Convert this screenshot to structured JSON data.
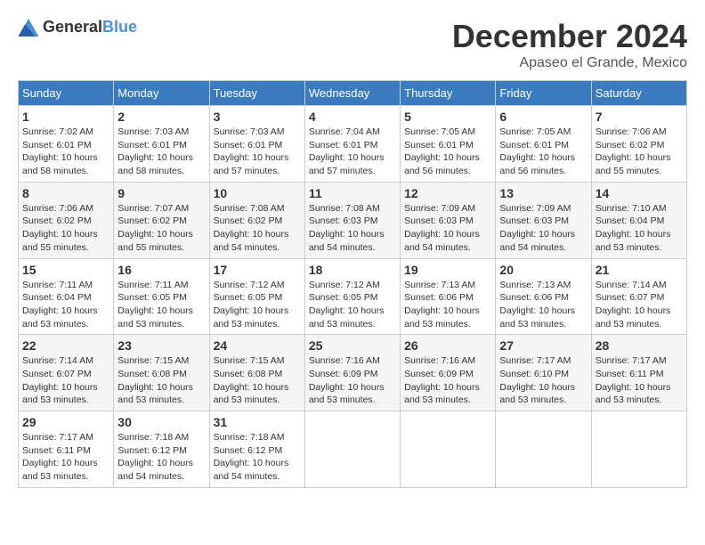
{
  "logo": {
    "general": "General",
    "blue": "Blue"
  },
  "header": {
    "month": "December 2024",
    "location": "Apaseo el Grande, Mexico"
  },
  "weekdays": [
    "Sunday",
    "Monday",
    "Tuesday",
    "Wednesday",
    "Thursday",
    "Friday",
    "Saturday"
  ],
  "weeks": [
    [
      {
        "day": "1",
        "info": "Sunrise: 7:02 AM\nSunset: 6:01 PM\nDaylight: 10 hours\nand 58 minutes."
      },
      {
        "day": "2",
        "info": "Sunrise: 7:03 AM\nSunset: 6:01 PM\nDaylight: 10 hours\nand 58 minutes."
      },
      {
        "day": "3",
        "info": "Sunrise: 7:03 AM\nSunset: 6:01 PM\nDaylight: 10 hours\nand 57 minutes."
      },
      {
        "day": "4",
        "info": "Sunrise: 7:04 AM\nSunset: 6:01 PM\nDaylight: 10 hours\nand 57 minutes."
      },
      {
        "day": "5",
        "info": "Sunrise: 7:05 AM\nSunset: 6:01 PM\nDaylight: 10 hours\nand 56 minutes."
      },
      {
        "day": "6",
        "info": "Sunrise: 7:05 AM\nSunset: 6:01 PM\nDaylight: 10 hours\nand 56 minutes."
      },
      {
        "day": "7",
        "info": "Sunrise: 7:06 AM\nSunset: 6:02 PM\nDaylight: 10 hours\nand 55 minutes."
      }
    ],
    [
      {
        "day": "8",
        "info": "Sunrise: 7:06 AM\nSunset: 6:02 PM\nDaylight: 10 hours\nand 55 minutes."
      },
      {
        "day": "9",
        "info": "Sunrise: 7:07 AM\nSunset: 6:02 PM\nDaylight: 10 hours\nand 55 minutes."
      },
      {
        "day": "10",
        "info": "Sunrise: 7:08 AM\nSunset: 6:02 PM\nDaylight: 10 hours\nand 54 minutes."
      },
      {
        "day": "11",
        "info": "Sunrise: 7:08 AM\nSunset: 6:03 PM\nDaylight: 10 hours\nand 54 minutes."
      },
      {
        "day": "12",
        "info": "Sunrise: 7:09 AM\nSunset: 6:03 PM\nDaylight: 10 hours\nand 54 minutes."
      },
      {
        "day": "13",
        "info": "Sunrise: 7:09 AM\nSunset: 6:03 PM\nDaylight: 10 hours\nand 54 minutes."
      },
      {
        "day": "14",
        "info": "Sunrise: 7:10 AM\nSunset: 6:04 PM\nDaylight: 10 hours\nand 53 minutes."
      }
    ],
    [
      {
        "day": "15",
        "info": "Sunrise: 7:11 AM\nSunset: 6:04 PM\nDaylight: 10 hours\nand 53 minutes."
      },
      {
        "day": "16",
        "info": "Sunrise: 7:11 AM\nSunset: 6:05 PM\nDaylight: 10 hours\nand 53 minutes."
      },
      {
        "day": "17",
        "info": "Sunrise: 7:12 AM\nSunset: 6:05 PM\nDaylight: 10 hours\nand 53 minutes."
      },
      {
        "day": "18",
        "info": "Sunrise: 7:12 AM\nSunset: 6:05 PM\nDaylight: 10 hours\nand 53 minutes."
      },
      {
        "day": "19",
        "info": "Sunrise: 7:13 AM\nSunset: 6:06 PM\nDaylight: 10 hours\nand 53 minutes."
      },
      {
        "day": "20",
        "info": "Sunrise: 7:13 AM\nSunset: 6:06 PM\nDaylight: 10 hours\nand 53 minutes."
      },
      {
        "day": "21",
        "info": "Sunrise: 7:14 AM\nSunset: 6:07 PM\nDaylight: 10 hours\nand 53 minutes."
      }
    ],
    [
      {
        "day": "22",
        "info": "Sunrise: 7:14 AM\nSunset: 6:07 PM\nDaylight: 10 hours\nand 53 minutes."
      },
      {
        "day": "23",
        "info": "Sunrise: 7:15 AM\nSunset: 6:08 PM\nDaylight: 10 hours\nand 53 minutes."
      },
      {
        "day": "24",
        "info": "Sunrise: 7:15 AM\nSunset: 6:08 PM\nDaylight: 10 hours\nand 53 minutes."
      },
      {
        "day": "25",
        "info": "Sunrise: 7:16 AM\nSunset: 6:09 PM\nDaylight: 10 hours\nand 53 minutes."
      },
      {
        "day": "26",
        "info": "Sunrise: 7:16 AM\nSunset: 6:09 PM\nDaylight: 10 hours\nand 53 minutes."
      },
      {
        "day": "27",
        "info": "Sunrise: 7:17 AM\nSunset: 6:10 PM\nDaylight: 10 hours\nand 53 minutes."
      },
      {
        "day": "28",
        "info": "Sunrise: 7:17 AM\nSunset: 6:11 PM\nDaylight: 10 hours\nand 53 minutes."
      }
    ],
    [
      {
        "day": "29",
        "info": "Sunrise: 7:17 AM\nSunset: 6:11 PM\nDaylight: 10 hours\nand 53 minutes."
      },
      {
        "day": "30",
        "info": "Sunrise: 7:18 AM\nSunset: 6:12 PM\nDaylight: 10 hours\nand 54 minutes."
      },
      {
        "day": "31",
        "info": "Sunrise: 7:18 AM\nSunset: 6:12 PM\nDaylight: 10 hours\nand 54 minutes."
      },
      {
        "day": "",
        "info": ""
      },
      {
        "day": "",
        "info": ""
      },
      {
        "day": "",
        "info": ""
      },
      {
        "day": "",
        "info": ""
      }
    ]
  ]
}
